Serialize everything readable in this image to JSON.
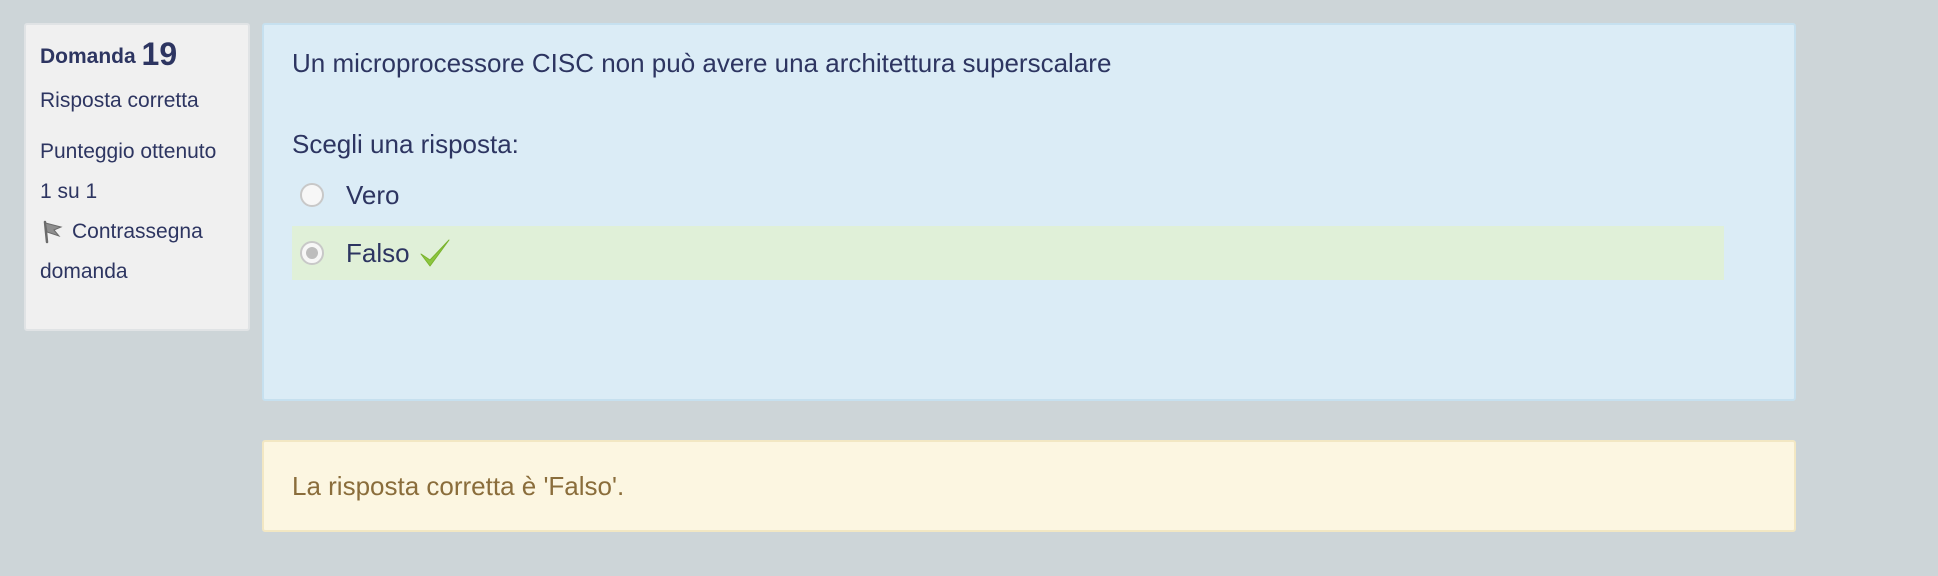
{
  "question": {
    "label": "Domanda",
    "number": "19",
    "state": "Risposta corretta",
    "grade_label": "Punteggio ottenuto",
    "grade_value": "1 su 1",
    "flag_label": "Contrassegna",
    "flag_label_line2": "domanda",
    "text": "Un microprocessore CISC non può avere una architettura superscalare",
    "prompt": "Scegli una risposta:",
    "options": [
      {
        "label": "Vero",
        "selected": false,
        "correct": false
      },
      {
        "label": "Falso",
        "selected": true,
        "correct": true
      }
    ],
    "right_answer": "La risposta corretta è 'Falso'."
  },
  "colors": {
    "background": "#cdd5d8",
    "info_bg": "#f0f0f0",
    "formulation_bg": "#dbecf6",
    "correct_bg": "#e0f0d8",
    "feedback_bg": "#fcf6e1",
    "feedback_text": "#8a6d3b",
    "check": "#8cc63f"
  },
  "icons": {
    "flag": "flag-icon",
    "correct": "check-icon"
  }
}
